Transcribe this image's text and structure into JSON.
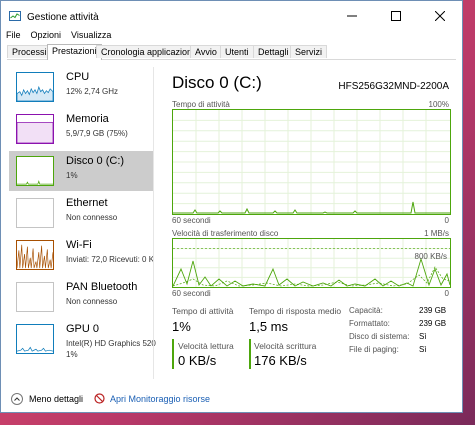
{
  "window": {
    "title": "Gestione attività"
  },
  "menu": [
    "File",
    "Opzioni",
    "Visualizza"
  ],
  "tabs": [
    "Processi",
    "Prestazioni",
    "Cronologia applicazioni",
    "Avvio",
    "Utenti",
    "Dettagli",
    "Servizi"
  ],
  "active_tab": "Prestazioni",
  "sidebar": [
    {
      "title": "CPU",
      "sub": "12% 2,74 GHz",
      "color": "#117dbb"
    },
    {
      "title": "Memoria",
      "sub": "5,9/7,9 GB (75%)",
      "color": "#8b12ae"
    },
    {
      "title": "Disco 0 (C:)",
      "sub": "1%",
      "color": "#4da60c"
    },
    {
      "title": "Ethernet",
      "sub": "Non connesso",
      "color": "#a74f01"
    },
    {
      "title": "Wi-Fi",
      "sub": "Inviati: 72,0 Ricevuti: 0 K",
      "color": "#a74f01"
    },
    {
      "title": "PAN Bluetooth",
      "sub": "Non connesso",
      "color": "#a74f01"
    },
    {
      "title": "GPU 0",
      "sub": "Intel(R) HD Graphics 520",
      "sub2": "1%",
      "color": "#117dbb"
    }
  ],
  "main": {
    "title": "Disco 0 (C:)",
    "model": "HFS256G32MND-2200A",
    "graph1": {
      "label": "Tempo di attività",
      "max": "100%",
      "time": "60 secondi",
      "zero": "0"
    },
    "graph2": {
      "label": "Velocità di trasferimento disco",
      "max": "1 MB/s",
      "mid": "800 KB/s",
      "time": "60 secondi",
      "zero": "0"
    }
  },
  "stats": {
    "active_time_label": "Tempo di attività",
    "active_time_value": "1%",
    "response_label": "Tempo di risposta medio",
    "response_value": "1,5 ms",
    "read_label": "Velocità lettura",
    "read_value": "0 KB/s",
    "write_label": "Velocità scrittura",
    "write_value": "176 KB/s"
  },
  "details": [
    {
      "label": "Capacità:",
      "value": "239 GB"
    },
    {
      "label": "Formattato:",
      "value": "239 GB"
    },
    {
      "label": "Disco di sistema:",
      "value": "Sì"
    },
    {
      "label": "File di paging:",
      "value": "Sì"
    }
  ],
  "footer": {
    "less_details": "Meno dettagli",
    "open_monitor": "Apri Monitoraggio risorse"
  },
  "colors": {
    "accent_disk": "#4da60c",
    "link": "#1a5fb4"
  }
}
